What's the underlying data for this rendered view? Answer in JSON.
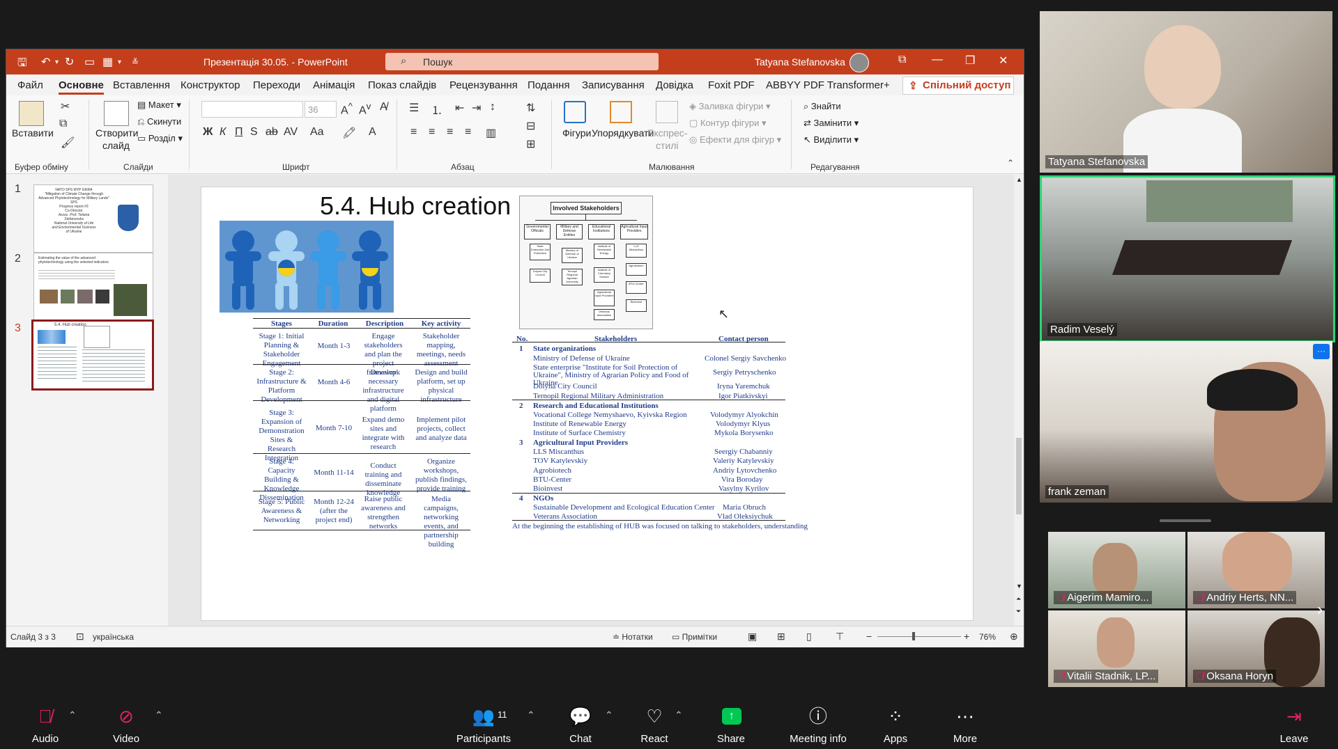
{
  "ppt": {
    "doc_title": "Презентація 30.05.  -  PowerPoint",
    "search_placeholder": "Пошук",
    "user": "Tatyana Stefanovska",
    "menu": [
      "Файл",
      "Основне",
      "Вставлення",
      "Конструктор",
      "Переходи",
      "Анімація",
      "Показ слайдів",
      "Рецензування",
      "Подання",
      "Записування",
      "Довідка",
      "Foxit PDF",
      "ABBYY PDF Transformer+"
    ],
    "share": "Спільний доступ",
    "ribbon": {
      "paste": "Вставити",
      "new_slide_1": "Створити",
      "new_slide_2": "слайд",
      "layout": "Макет",
      "reset": "Скинути",
      "section": "Розділ",
      "font_size": "36",
      "shapes": "Фігури",
      "arrange": "Упорядкувати",
      "quick_styles_1": "Експрес-",
      "quick_styles_2": "стилі",
      "shape_fill": "Заливка фігури",
      "shape_outline": "Контур фігури",
      "shape_effects": "Ефекти для фігур",
      "find": "Знайти",
      "replace": "Замінити",
      "select": "Виділити",
      "groups": {
        "clipboard": "Буфер обміну",
        "slides": "Слайди",
        "font": "Шрифт",
        "paragraph": "Абзац",
        "drawing": "Малювання",
        "editing": "Редагування"
      }
    },
    "thumbnails": [
      {
        "num": "1",
        "lines": [
          "NATO SPS MYP G6084",
          "\"Mitigation of Climate Change through",
          "Advanced Phytotechnology for Military Lands\"",
          "SPS",
          "Progress report #3",
          "Co-Director",
          "Assoc. Prof. Tetiana",
          "Stefanovska",
          "National University of Life",
          "and Environmental Sciences",
          "of Ukraine"
        ]
      },
      {
        "num": "2",
        "title": "Estimating the value of the advanced phytotechnology using the selected indicators"
      },
      {
        "num": "3",
        "title": "5.4. Hub creation"
      }
    ],
    "status": {
      "slide": "Слайд 3 з 3",
      "lang": "українська",
      "notes": "Нотатки",
      "comments": "Примітки",
      "zoom": "76%"
    }
  },
  "slide": {
    "title": "5.4. Hub creation",
    "diagram": {
      "top": "Involved Stakeholders",
      "columns": [
        {
          "head": "Governmental Officials",
          "items": [
            "State Enterprise Soil Protection",
            "Dolyna City Council"
          ]
        },
        {
          "head": "Military and Defense Entities",
          "items": [
            "Ministry of Defense of Ukraine",
            "Ternopil Regional Agrarian University"
          ]
        },
        {
          "head": "Educational Institutions",
          "items": [
            "Institute of Renewable Energy",
            "Institute of Chemistry Surface",
            "Agricultural Input Providers",
            "Veterans Association"
          ]
        },
        {
          "head": "Agricultural Input Providers",
          "items": [
            "LLS Miscanthus",
            "Agrobiotech",
            "BTU-Center",
            "Bioinvest"
          ]
        }
      ]
    },
    "stages_table": {
      "headers": [
        "Stages",
        "Duration",
        "Description",
        "Key activity"
      ],
      "rows": [
        {
          "stage": "Stage 1: Initial Planning & Stakeholder Engagement",
          "duration": "Month 1-3",
          "description": "Engage stakeholders and plan the project framework",
          "activity": "Stakeholder mapping, meetings, needs assessment"
        },
        {
          "stage": "Stage 2: Infrastructure & Platform Development",
          "duration": "Month 4-6",
          "description": "Develop necessary infrastructure and digital platform",
          "activity": "Design and build platform, set up physical infrastructure"
        },
        {
          "stage": "Stage 3: Expansion of Demonstration Sites & Research Integration",
          "duration": "Month 7-10",
          "description": "Expand demo sites and integrate with research",
          "activity": "Implement pilot projects, collect and analyze data"
        },
        {
          "stage": "Stage 4: Capacity Building & Knowledge Dissemination",
          "duration": "Month 11-14",
          "description": "Conduct training and disseminate knowledge",
          "activity": "Organize workshops, publish findings, provide training"
        },
        {
          "stage": "Stage 5: Public Awareness & Networking",
          "duration": "Month 12-24 (after the project end)",
          "description": "Raise public awareness and strengthen networks",
          "activity": "Media campaigns, networking events, and partnership building"
        }
      ]
    },
    "stakeholders_table": {
      "headers": [
        "No.",
        "Stakeholders",
        "Contact person"
      ],
      "groups": [
        {
          "no": "1",
          "name": "State organizations",
          "rows": [
            {
              "s": "Ministry of Defense of Ukraine",
              "c": "Colonel Sergiy Savchenko"
            },
            {
              "s": "State enterprise \"Institute for Soil Protection of Ukraine\", Ministry of Agrarian Policy and Food of Ukraine",
              "c": "Sergiy Petryschenko"
            },
            {
              "s": "Dolyna City Council",
              "c": "Iryna Yaremchuk"
            },
            {
              "s": "Ternopil Regional Military Administration",
              "c": "Igor Piatkivskyi"
            }
          ]
        },
        {
          "no": "2",
          "name": "Research and Educational Institutions",
          "rows": [
            {
              "s": "Vocational College Nemyshaevo, Kyivska Region",
              "c": "Volodymyr Alyokchin"
            },
            {
              "s": "Institute of Renewable Energy",
              "c": "Volodymyr Klyus"
            },
            {
              "s": "Institute of Surface Chemistry",
              "c": "Mykola Borysenko"
            }
          ]
        },
        {
          "no": "3",
          "name": "Agricultural Input Providers",
          "rows": [
            {
              "s": "LLS Miscanthus",
              "c": "Seergiy Chabanniy"
            },
            {
              "s": "TOV Katylevskiy",
              "c": "Valeriy Katylevskiy"
            },
            {
              "s": "Agrobiotech",
              "c": "Andriy Lytovchenko"
            },
            {
              "s": "BTU-Center",
              "c": "Vira Boroday"
            },
            {
              "s": "Bioinvest",
              "c": "Vasylny Kyrilov"
            }
          ]
        },
        {
          "no": "4",
          "name": "NGOs",
          "rows": [
            {
              "s": "Sustainable Development and Ecological Education Center",
              "c": "Maria Obruch"
            },
            {
              "s": "Veterans Association",
              "c": "Vlad Oleksiychuk"
            }
          ]
        }
      ],
      "footer": "At the beginning the establishing of HUB was focused on talking to stakeholders, understanding"
    }
  },
  "zoom": {
    "participants_big": [
      "Tatyana Stefanovska",
      "Radim Veselý",
      "frank zeman"
    ],
    "participants_small": [
      "Aigerim Mamiro...",
      "Andriy Herts, NN...",
      "Vitalii Stadnik, LP...",
      "Oksana Horyn"
    ],
    "more_btn": "···",
    "toolbar": {
      "audio": "Audio",
      "video": "Video",
      "participants": "Participants",
      "participants_count": "11",
      "chat": "Chat",
      "react": "React",
      "share": "Share",
      "meeting_info": "Meeting info",
      "apps": "Apps",
      "more": "More",
      "leave": "Leave"
    }
  },
  "colors": {
    "ppt_accent": "#c43e1c",
    "zoom_active_border": "#2ed47a",
    "zoom_share": "#00c853",
    "slide_table_text": "#1f3c8a"
  }
}
